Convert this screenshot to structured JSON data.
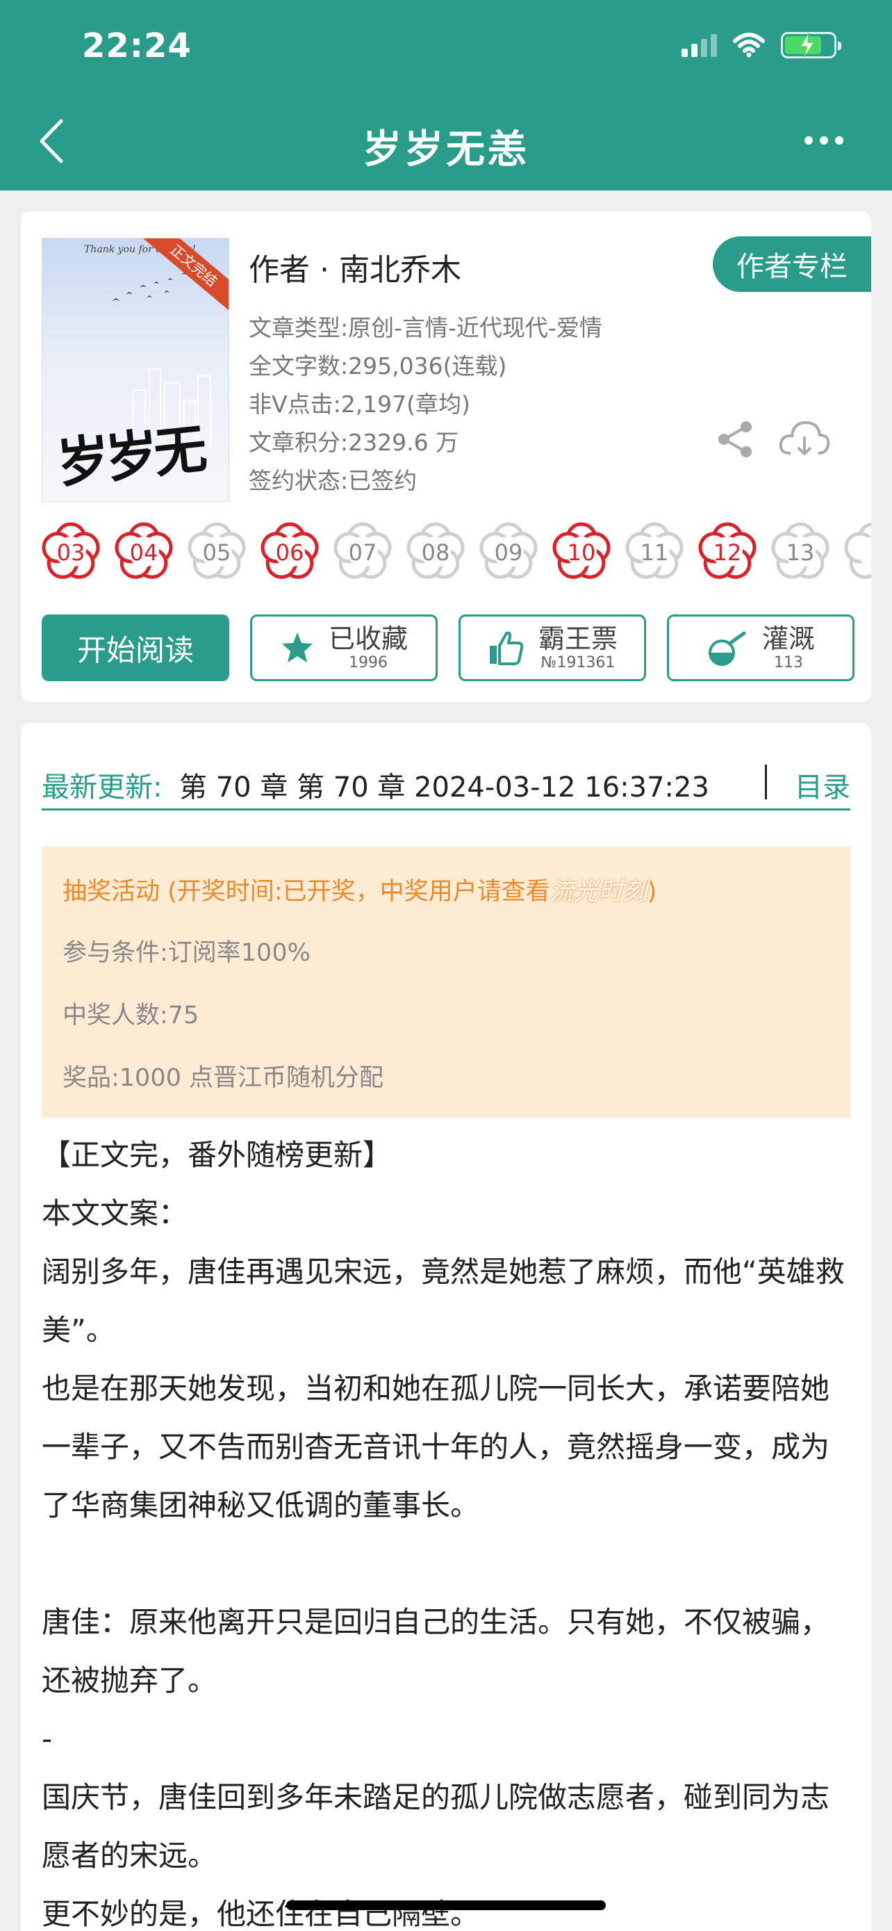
{
  "status_bar": {
    "time": "22:24"
  },
  "header": {
    "title": "岁岁无恙"
  },
  "book": {
    "author": "作者 · 南北乔木",
    "author_column_label": "作者专栏",
    "cover_ribbon": "正文完结",
    "cover_text": "Thank you for coming!",
    "meta": [
      "文章类型:原创-言情-近代现代-爱情",
      "全文字数:295,036(连载)",
      "非Ⅴ点击:2,197(章均)",
      "文章积分:2329.6 万",
      "签约状态:已签约"
    ],
    "flowers": [
      {
        "label": "03",
        "active": true
      },
      {
        "label": "04",
        "active": true
      },
      {
        "label": "05",
        "active": false
      },
      {
        "label": "06",
        "active": true
      },
      {
        "label": "07",
        "active": false
      },
      {
        "label": "08",
        "active": false
      },
      {
        "label": "09",
        "active": false
      },
      {
        "label": "10",
        "active": true
      },
      {
        "label": "11",
        "active": false
      },
      {
        "label": "12",
        "active": true
      },
      {
        "label": "13",
        "active": false
      },
      {
        "label": "",
        "active": false
      }
    ],
    "actions": {
      "read_label": "开始阅读",
      "collect_label": "已收藏",
      "collect_count": "1996",
      "vote_label": "霸王票",
      "vote_rank": "№191361",
      "water_label": "灌溉",
      "water_count": "113"
    }
  },
  "latest_update": {
    "label": "最新更新:",
    "value": "第 70 章 第 70 章 2024-03-12 16:37:23",
    "toc_label": "目录"
  },
  "lottery": {
    "title": "抽奖活动 (开奖时间:已开奖，中奖用户请查看",
    "title_tag": "流光时刻",
    "title_end": ")",
    "condition": "参与条件:订阅率100%",
    "winners": "中奖人数:75",
    "prize": "奖品:1000 点晋江币随机分配"
  },
  "synopsis": [
    "【正文完，番外随榜更新】",
    "本文文案：",
    "阔别多年，唐佳再遇见宋远，竟然是她惹了麻烦，而他“英雄救美”。",
    "也是在那天她发现，当初和她在孤儿院一同长大，承诺要陪她一辈子，又不告而别杳无音讯十年的人，竟然摇身一变，成为了华商集团神秘又低调的董事长。",
    "",
    "唐佳：原来他离开只是回归自己的生活。只有她，不仅被骗，还被抛弃了。",
    "-",
    "国庆节，唐佳回到多年未踏足的孤儿院做志愿者，碰到同为志愿者的宋远。",
    "更不妙的是，他还住在自己隔壁。"
  ],
  "colors": {
    "accent": "#2a9c8a",
    "flower_red": "#d9232a",
    "lottery_bg": "#feebd3",
    "lottery_title": "#ec8a2a"
  }
}
